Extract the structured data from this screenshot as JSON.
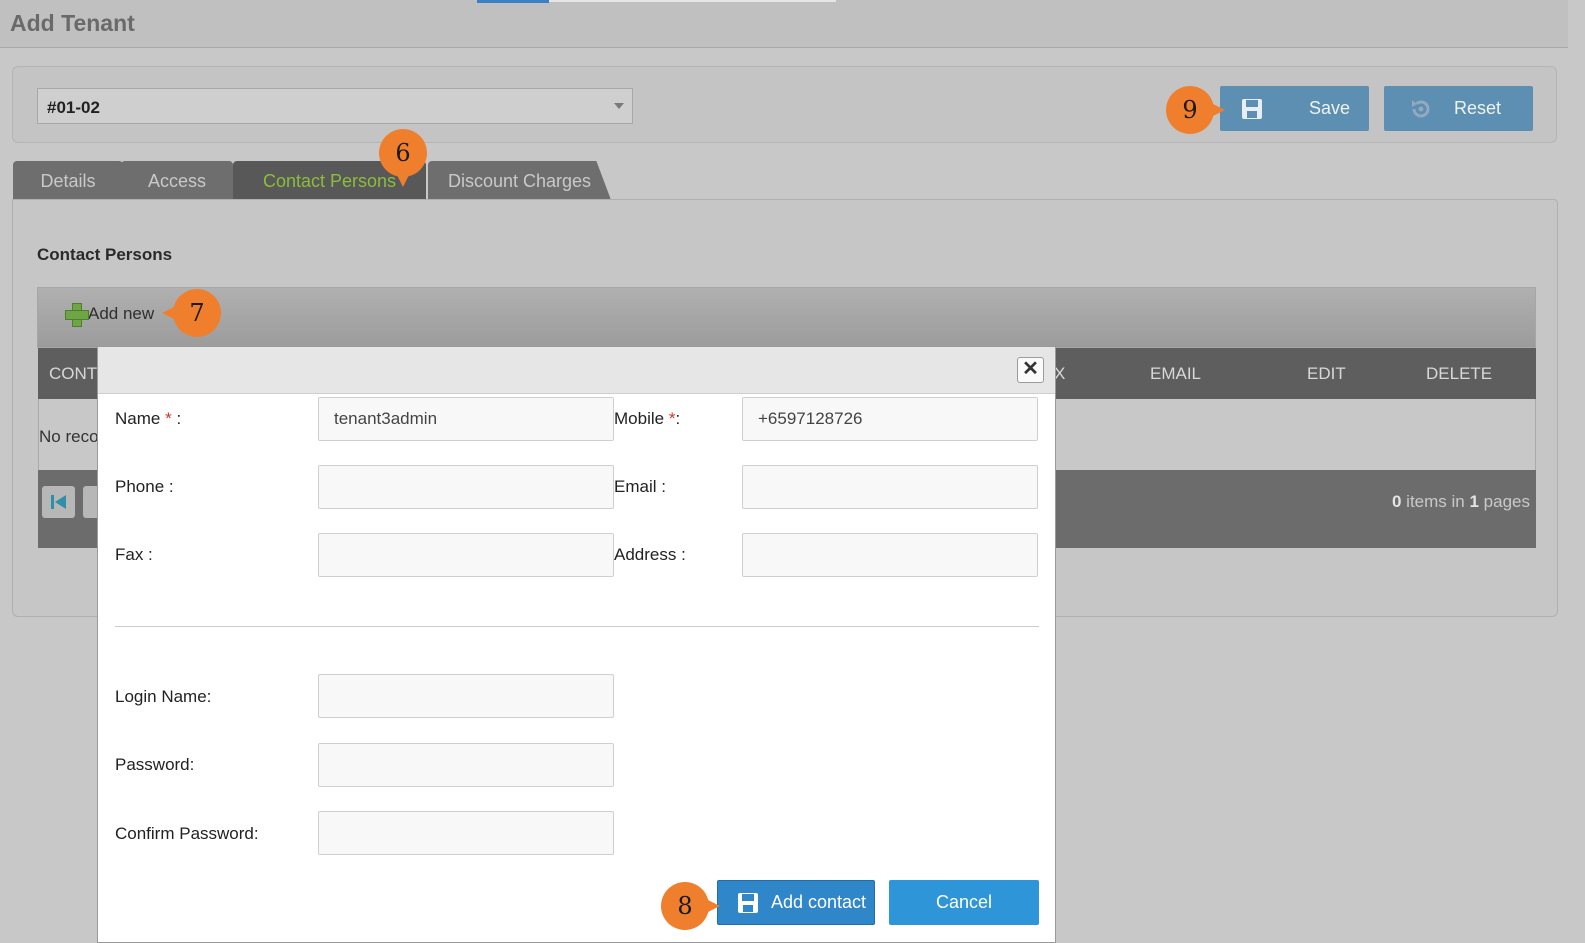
{
  "page": {
    "title": "Add Tenant"
  },
  "unit_select": {
    "value": "#01-02"
  },
  "toolbar": {
    "save_label": "Save",
    "reset_label": "Reset"
  },
  "tabs": [
    {
      "label": "Details",
      "active": false
    },
    {
      "label": "Access",
      "active": false
    },
    {
      "label": "Contact Persons",
      "active": true
    },
    {
      "label": "Discount Charges",
      "active": false
    }
  ],
  "contacts_section": {
    "title": "Contact Persons",
    "add_new_label": "Add new",
    "grid": {
      "headers": {
        "col1": "CONT",
        "fax": "X",
        "email": "EMAIL",
        "edit": "EDIT",
        "delete": "DELETE"
      },
      "no_records": "No reco",
      "pager": {
        "count": "0",
        "items_in": " items in ",
        "pages_count": "1",
        "pages_label": " pages"
      }
    }
  },
  "modal": {
    "fields": {
      "name": {
        "label": "Name",
        "required_mark": "*",
        "suffix": " :",
        "value": "tenant3admin"
      },
      "mobile": {
        "label": "Mobile",
        "required_mark": "*",
        "suffix": ":",
        "value": "+6597128726"
      },
      "phone": {
        "label": "Phone :",
        "value": ""
      },
      "email": {
        "label": "Email :",
        "value": ""
      },
      "fax": {
        "label": "Fax :",
        "value": ""
      },
      "address": {
        "label": "Address :",
        "value": ""
      },
      "login_name": {
        "label": "Login Name:",
        "value": ""
      },
      "password": {
        "label": "Password:",
        "value": ""
      },
      "confirm_password": {
        "label": "Confirm Password:",
        "value": ""
      }
    },
    "close_symbol": "✕",
    "add_contact_label": "Add contact",
    "cancel_label": "Cancel"
  },
  "callouts": {
    "six": "6",
    "seven": "7",
    "eight": "8",
    "nine": "9"
  },
  "colors": {
    "callout": "#ef7f2d",
    "active_tab_text": "#8cbd3d",
    "primary_button": "#2f86c9",
    "required": "#d9302b"
  },
  "icons": {
    "save": "floppy-disk-icon",
    "reset": "reset-icon",
    "add": "plus-icon",
    "close": "close-icon",
    "pager_first": "first-page-icon"
  }
}
